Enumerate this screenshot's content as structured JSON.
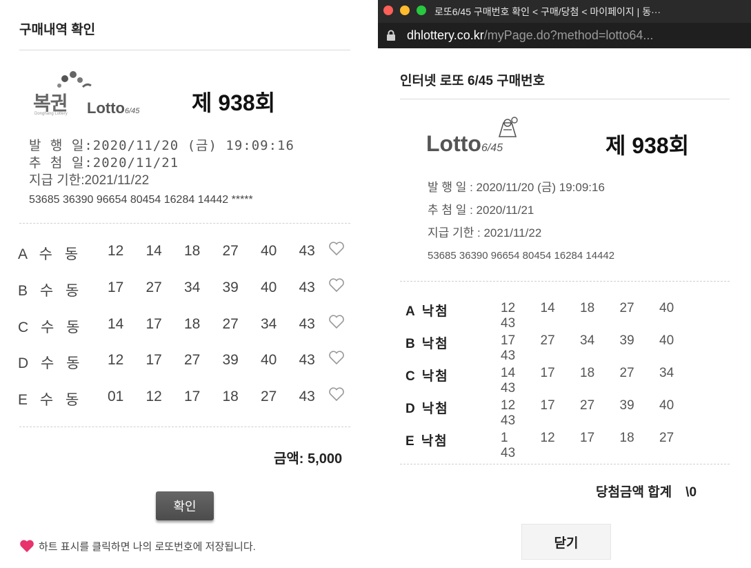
{
  "left": {
    "title": "구매내역 확인",
    "logo": {
      "text": "복권",
      "sub": "Donghang Lottery",
      "lotto": "Lotto",
      "lotto_sub": "6/45"
    },
    "round": "제 938회",
    "issue_line": "발 행 일:2020/11/20 (금) 19:09:16",
    "draw_line": "추 첨 일:2020/11/21",
    "deadline_line": "지급 기한:2021/11/22",
    "serial": "53685 36390 96654 80454 16284 14442 *****",
    "rows": [
      {
        "label": "A 수 동",
        "numbers": [
          "12",
          "14",
          "18",
          "27",
          "40",
          "43"
        ]
      },
      {
        "label": "B 수 동",
        "numbers": [
          "17",
          "27",
          "34",
          "39",
          "40",
          "43"
        ]
      },
      {
        "label": "C 수 동",
        "numbers": [
          "14",
          "17",
          "18",
          "27",
          "34",
          "43"
        ]
      },
      {
        "label": "D 수 동",
        "numbers": [
          "12",
          "17",
          "27",
          "39",
          "40",
          "43"
        ]
      },
      {
        "label": "E 수 동",
        "numbers": [
          "01",
          "12",
          "17",
          "18",
          "27",
          "43"
        ]
      }
    ],
    "amount": "금액: 5,000",
    "confirm_label": "확인",
    "notice": "하트 표시를 클릭하면 나의 로또번호에 저장됩니다."
  },
  "right": {
    "browser": {
      "title": "로또6/45 구매번호 확인 < 구매/당첨 < 마이페이지 | 동···",
      "url_host": "dhlottery.co.kr",
      "url_path": "/myPage.do?method=lotto64..."
    },
    "title": "인터넷 로또 6/45 구매번호",
    "logo": {
      "lotto": "Lotto",
      "lotto_sub": "6/45"
    },
    "round": "제 938회",
    "issue_line": "발  행  일 : 2020/11/20 (금) 19:09:16",
    "draw_line": "추  첨  일 : 2020/11/21",
    "deadline_line": "지급 기한 : 2021/11/22",
    "serial": "53685 36390 96654 80454 16284 14442",
    "rows": [
      {
        "letter": "A",
        "status": "낙첨",
        "numbers": [
          "12",
          "14",
          "18",
          "27",
          "40",
          "43"
        ]
      },
      {
        "letter": "B",
        "status": "낙첨",
        "numbers": [
          "17",
          "27",
          "34",
          "39",
          "40",
          "43"
        ]
      },
      {
        "letter": "C",
        "status": "낙첨",
        "numbers": [
          "14",
          "17",
          "18",
          "27",
          "34",
          "43"
        ]
      },
      {
        "letter": "D",
        "status": "낙첨",
        "numbers": [
          "12",
          "17",
          "27",
          "39",
          "40",
          "43"
        ]
      },
      {
        "letter": "E",
        "status": "낙첨",
        "numbers": [
          "1",
          "12",
          "17",
          "18",
          "27",
          "43"
        ]
      }
    ],
    "total_label": "당첨금액 합계",
    "total_value": "\\0",
    "close_label": "닫기"
  },
  "colors": {
    "heart": "#e8336d",
    "confirm_button": "#555555",
    "close_button": "#f4f4f4"
  },
  "icons": {
    "heart_outline": "heart-outline-icon",
    "heart_filled": "heart-filled-icon",
    "lock": "lock-icon"
  }
}
